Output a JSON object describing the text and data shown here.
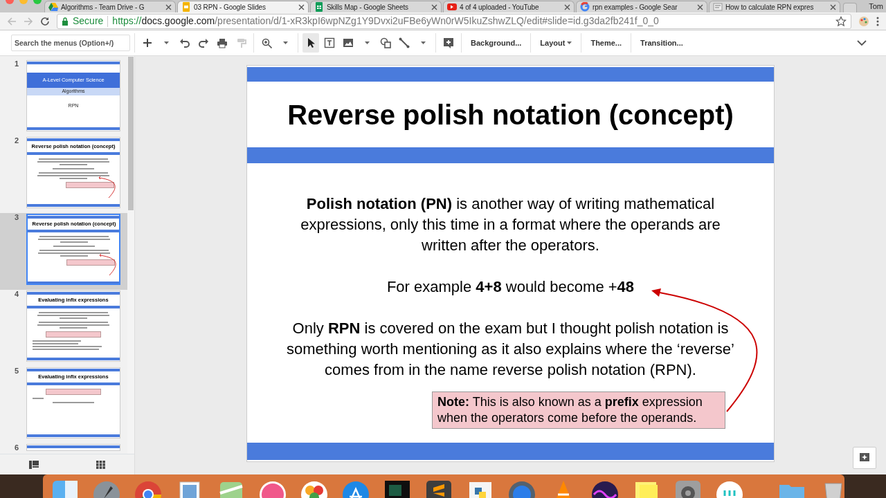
{
  "browser": {
    "tabs": [
      {
        "title": "Algorithms - Team Drive - G",
        "selected": false
      },
      {
        "title": "03 RPN - Google Slides",
        "selected": true
      },
      {
        "title": "Skills Map - Google Sheets",
        "selected": false
      },
      {
        "title": "4 of 4 uploaded - YouTube",
        "selected": false
      },
      {
        "title": "rpn examples - Google Sear",
        "selected": false
      },
      {
        "title": "How to calculate RPN expres",
        "selected": false
      }
    ],
    "profile": "Tom",
    "address": {
      "secure_label": "Secure",
      "scheme": "https://",
      "host": "docs.google.com",
      "path": "/presentation/d/1-xR3kpI6wpNZg1Y9Dvxi2uFBe6yWn0rW5IkuZshwZLQ/edit#slide=id.g3da2fb241f_0_0"
    }
  },
  "toolbar": {
    "search": {
      "placeholder": "Search the menus (Option+/)"
    },
    "buttons": [
      {
        "label": "Background...",
        "dropdown": false
      },
      {
        "label": "Layout",
        "dropdown": true
      },
      {
        "label": "Theme...",
        "dropdown": false
      },
      {
        "label": "Transition...",
        "dropdown": false
      }
    ]
  },
  "filmstrip": [
    {
      "number": "1",
      "selected": false,
      "kind": "title",
      "title": "A-Level Computer Science",
      "subtitle": "Algorithms",
      "caption": "RPN"
    },
    {
      "number": "2",
      "selected": false,
      "kind": "content",
      "title": "Reverse polish notation (concept)",
      "arrow": true,
      "blocks": [
        {
          "kind": "para"
        },
        {
          "kind": "line"
        },
        {
          "kind": "para"
        },
        {
          "kind": "note"
        }
      ]
    },
    {
      "number": "3",
      "selected": true,
      "kind": "content",
      "title": "Reverse polish notation (concept)",
      "arrow": true,
      "blocks": [
        {
          "kind": "para"
        },
        {
          "kind": "line"
        },
        {
          "kind": "para"
        },
        {
          "kind": "note"
        }
      ]
    },
    {
      "number": "4",
      "selected": false,
      "kind": "content",
      "title": "Evaluating infix expressions",
      "arrow": false,
      "blocks": [
        {
          "kind": "para"
        },
        {
          "kind": "para"
        },
        {
          "kind": "box"
        },
        {
          "kind": "list"
        }
      ]
    },
    {
      "number": "5",
      "selected": false,
      "kind": "content",
      "title": "Evaluating infix expressions",
      "arrow": false,
      "blocks": [
        {
          "kind": "box"
        },
        {
          "kind": "label"
        },
        {
          "kind": "line"
        }
      ]
    },
    {
      "number": "6",
      "selected": false,
      "kind": "partial"
    }
  ],
  "editor_slide": {
    "title": "Reverse polish notation (concept)",
    "arrow": true,
    "blocks": [
      {
        "kind": "para",
        "text": "**Polish notation (PN)** is another way of writing mathematical expressions, only this time in a format where the operands are written after the operators."
      },
      {
        "kind": "para",
        "text": "For example **4+8** would become +**48**"
      },
      {
        "kind": "para",
        "text": "Only **RPN** is covered on the exam but I thought polish notation is something worth mentioning as it also explains where the ‘reverse’ comes from in the name reverse polish notation (RPN)."
      },
      {
        "kind": "note",
        "text": "**Note:** This is also known as a **prefix** expression when the operators come before the operands."
      }
    ]
  }
}
